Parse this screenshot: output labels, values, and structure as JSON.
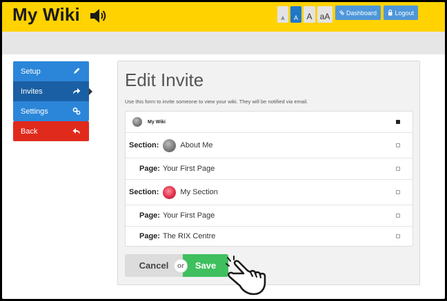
{
  "header": {
    "site_title": "My Wiki",
    "text_size_buttons": [
      "A",
      "A",
      "A",
      "aA"
    ],
    "dashboard_label": "Dashboard",
    "logout_label": "Logout"
  },
  "sidebar": {
    "items": [
      {
        "label": "Setup",
        "icon": "pencil-icon"
      },
      {
        "label": "Invites",
        "icon": "share-icon"
      },
      {
        "label": "Settings",
        "icon": "gears-icon"
      },
      {
        "label": "Back",
        "icon": "back-arrow-icon"
      }
    ]
  },
  "panel": {
    "title": "Edit Invite",
    "description": "Use this form to invite someone to view your wiki. They will be notified via email.",
    "rows": [
      {
        "prefix": "",
        "text": "My Wiki",
        "checked": true
      },
      {
        "prefix": "Section:",
        "text": "About Me",
        "checked": false
      },
      {
        "prefix": "Page:",
        "text": "Your First Page",
        "checked": false
      },
      {
        "prefix": "Section:",
        "text": "My Section",
        "checked": false
      },
      {
        "prefix": "Page:",
        "text": "Your First Page",
        "checked": false
      },
      {
        "prefix": "Page:",
        "text": "The RIX Centre",
        "checked": false
      }
    ]
  },
  "actions": {
    "cancel_label": "Cancel",
    "or_label": "or",
    "save_label": "Save"
  },
  "colors": {
    "header": "#ffd200",
    "primary": "#2b86d9",
    "active": "#1a5fa3",
    "danger": "#e02a1c",
    "success": "#3fbf5e"
  }
}
